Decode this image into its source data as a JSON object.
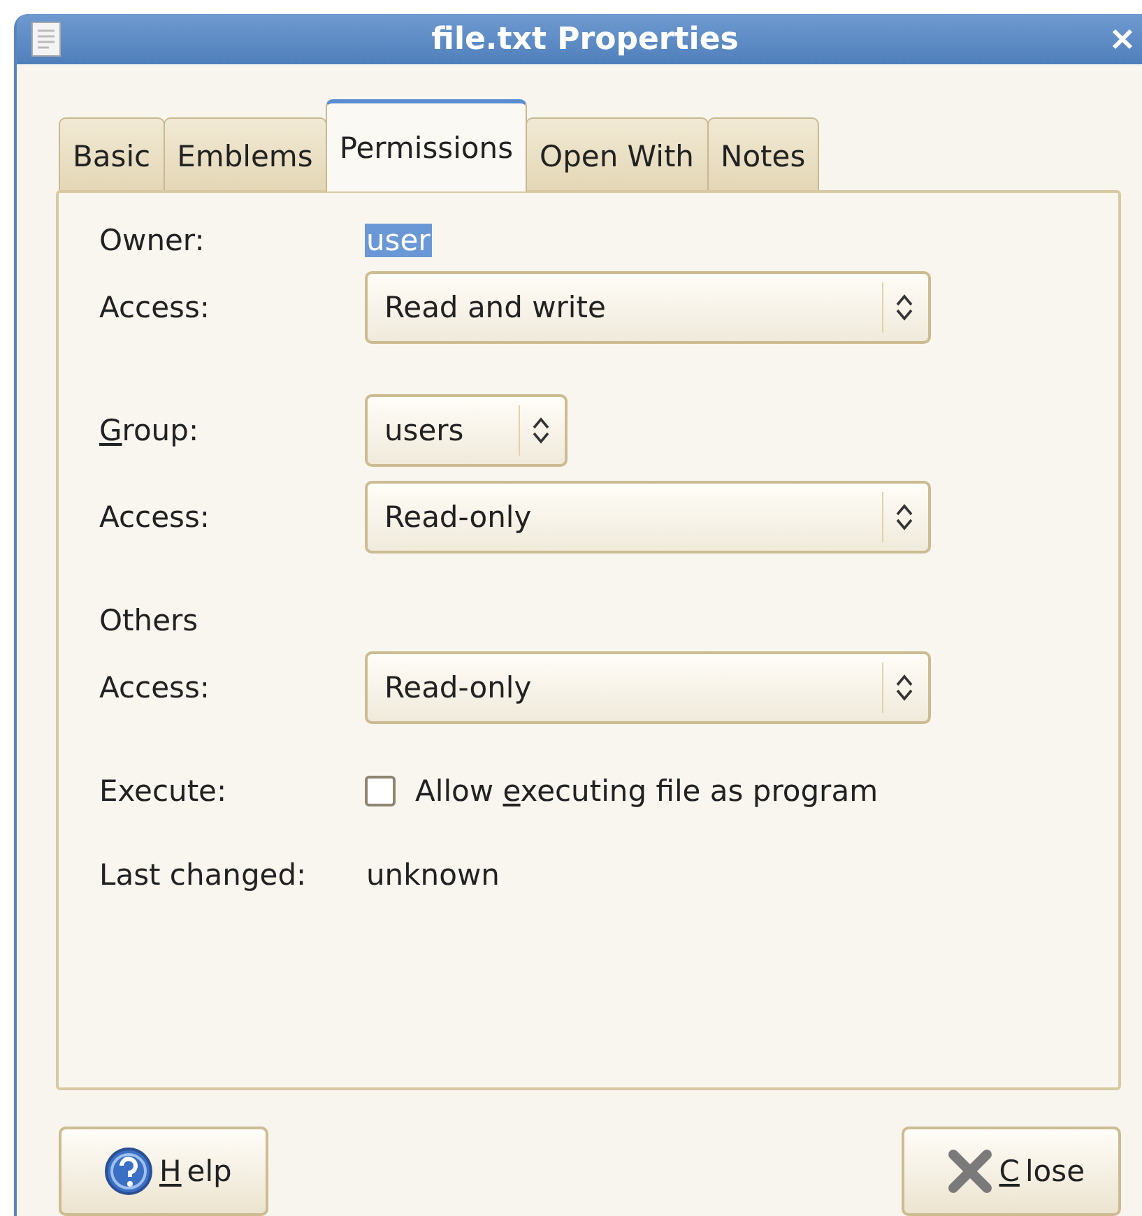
{
  "window": {
    "title": "file.txt Properties"
  },
  "tabs": [
    {
      "label": "Basic",
      "selected": false
    },
    {
      "label": "Emblems",
      "selected": false
    },
    {
      "label": "Permissions",
      "selected": true
    },
    {
      "label": "Open With",
      "selected": false
    },
    {
      "label": "Notes",
      "selected": false
    }
  ],
  "rows": [
    {
      "kind": "value",
      "label": {
        "before": "Owner:"
      },
      "value": "user",
      "selected": true
    },
    {
      "kind": "combo",
      "label": {
        "before": "Access:"
      },
      "value": "Read and write"
    },
    {
      "kind": "compact-combo",
      "label": {
        "mnemonic": "G",
        "after": "roup:"
      },
      "value": "users"
    },
    {
      "kind": "combo",
      "label": {
        "before": "Access:"
      },
      "value": "Read-only"
    },
    {
      "kind": "heading",
      "label": {
        "before": "Others"
      }
    },
    {
      "kind": "combo",
      "label": {
        "before": "Access:"
      },
      "value": "Read-only"
    },
    {
      "kind": "checkbox",
      "label": {
        "before": "Execute:"
      },
      "option": {
        "before": "Allow ",
        "mnemonic": "e",
        "after": "xecuting file as program"
      },
      "checked": false
    },
    {
      "kind": "value",
      "label": {
        "before": "Last changed:"
      },
      "value": "unknown",
      "selected": false
    }
  ],
  "buttons": [
    {
      "kind": "help",
      "label": {
        "mnemonic": "H",
        "after": "elp"
      }
    },
    {
      "kind": "close",
      "label": {
        "mnemonic": "C",
        "after": "lose"
      }
    }
  ]
}
